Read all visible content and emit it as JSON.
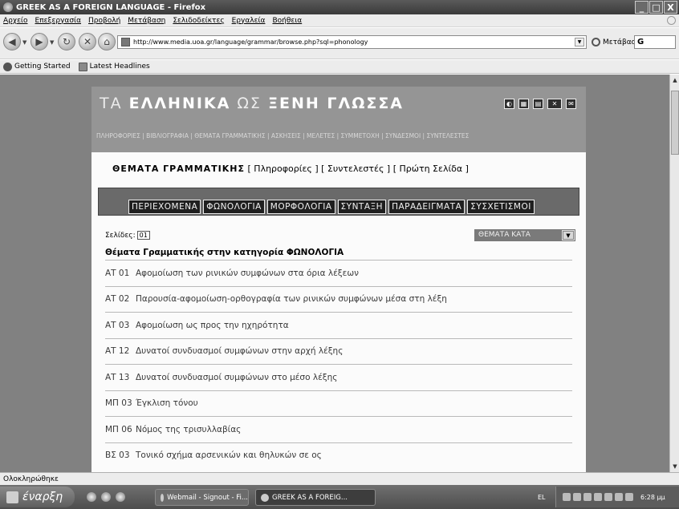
{
  "window": {
    "title": "GREEK AS A FOREIGN LANGUAGE - Firefox",
    "buttons": [
      "_",
      "□",
      "X"
    ]
  },
  "menu": [
    "Αρχείο",
    "Επεξεργασία",
    "Προβολή",
    "Μετάβαση",
    "Σελιδοδείκτες",
    "Εργαλεία",
    "Βοήθεια"
  ],
  "toolbar": {
    "url": "http://www.media.uoa.gr/language/grammar/browse.php?sql=phonology",
    "go_label": "Μετάβαση",
    "search_value": "G"
  },
  "bookmarks": [
    "Getting Started",
    "Latest Headlines"
  ],
  "site": {
    "title_light": "ΤΑ",
    "title_bold": "ΕΛΛΗΝΙΚΑ",
    "title_mid": "ΩΣ",
    "title_end": "ΞΕΝΗ ΓΛΩΣΣΑ",
    "top_nav": "ΠΛΗΡΟΦΟΡΙΕΣ | ΒΙΒΛΙΟΓΡΑΦΙΑ | ΘΕΜΑΤΑ ΓΡΑΜΜΑΤΙΚΗΣ | ΑΣΚΗΣΕΙΣ | ΜΕΛΕΤΕΣ | ΣΥΜΜΕΤΟΧΗ | ΣΥΝΔΕΣΜΟΙ | ΣΥΝΤΕΛΕΣΤΕΣ"
  },
  "breadcrumb": {
    "section": "ΘΕΜΑΤΑ ΓΡΑΜΜΑΤΙΚΗΣ",
    "links": "[ Πληροφορίες ] [ Συντελεστές ] [ Πρώτη Σελίδα ]"
  },
  "tabs": [
    "ΠΕΡΙΕΧΟΜΕΝΑ",
    "ΦΩΝΟΛΟΓΙΑ",
    "ΜΟΡΦΟΛΟΓΙΑ",
    "ΣΥΝΤΑΞΗ",
    "ΠΑΡΑΔΕΙΓΜΑΤΑ",
    "ΣΥΣΧΕΤΙΣΜΟΙ"
  ],
  "pages_label": "Σελίδες:",
  "page_current": "01",
  "sort_select": "ΘΕΜΑΤΑ ΚΑΤΑ",
  "category_heading": "Θέματα Γραμματικής στην κατηγορία ΦΩΝΟΛΟΓΙΑ",
  "items": [
    {
      "code": "ΑΤ 01",
      "text": "Αφομοίωση των ρινικών συμφώνων στα όρια λέξεων"
    },
    {
      "code": "ΑΤ 02",
      "text": "Παρουσία-αφομοίωση-ορθογραφία των ρινικών συμφώνων μέσα στη λέξη"
    },
    {
      "code": "ΑΤ 03",
      "text": "Αφομοίωση ως προς την ηχηρότητα"
    },
    {
      "code": "ΑΤ 12",
      "text": "Δυνατοί συνδυασμοί συμφώνων στην αρχή λέξης"
    },
    {
      "code": "ΑΤ 13",
      "text": "Δυνατοί συνδυασμοί συμφώνων στο μέσο λέξης"
    },
    {
      "code": "ΜΠ 03",
      "text": "Έγκλιση τόνου"
    },
    {
      "code": "ΜΠ 06",
      "text": "Νόμος της τρισυλλαβίας"
    },
    {
      "code": "ΒΣ 03",
      "text": "Τονικό σχήμα αρσενικών και θηλυκών σε ος"
    }
  ],
  "status": "Ολοκληρώθηκε",
  "taskbar": {
    "start": "έναρξη",
    "task1": "Webmail - Signout - Fi...",
    "task2": "GREEK AS A FOREIG...",
    "lang": "EL",
    "clock": "6:28 μμ"
  }
}
